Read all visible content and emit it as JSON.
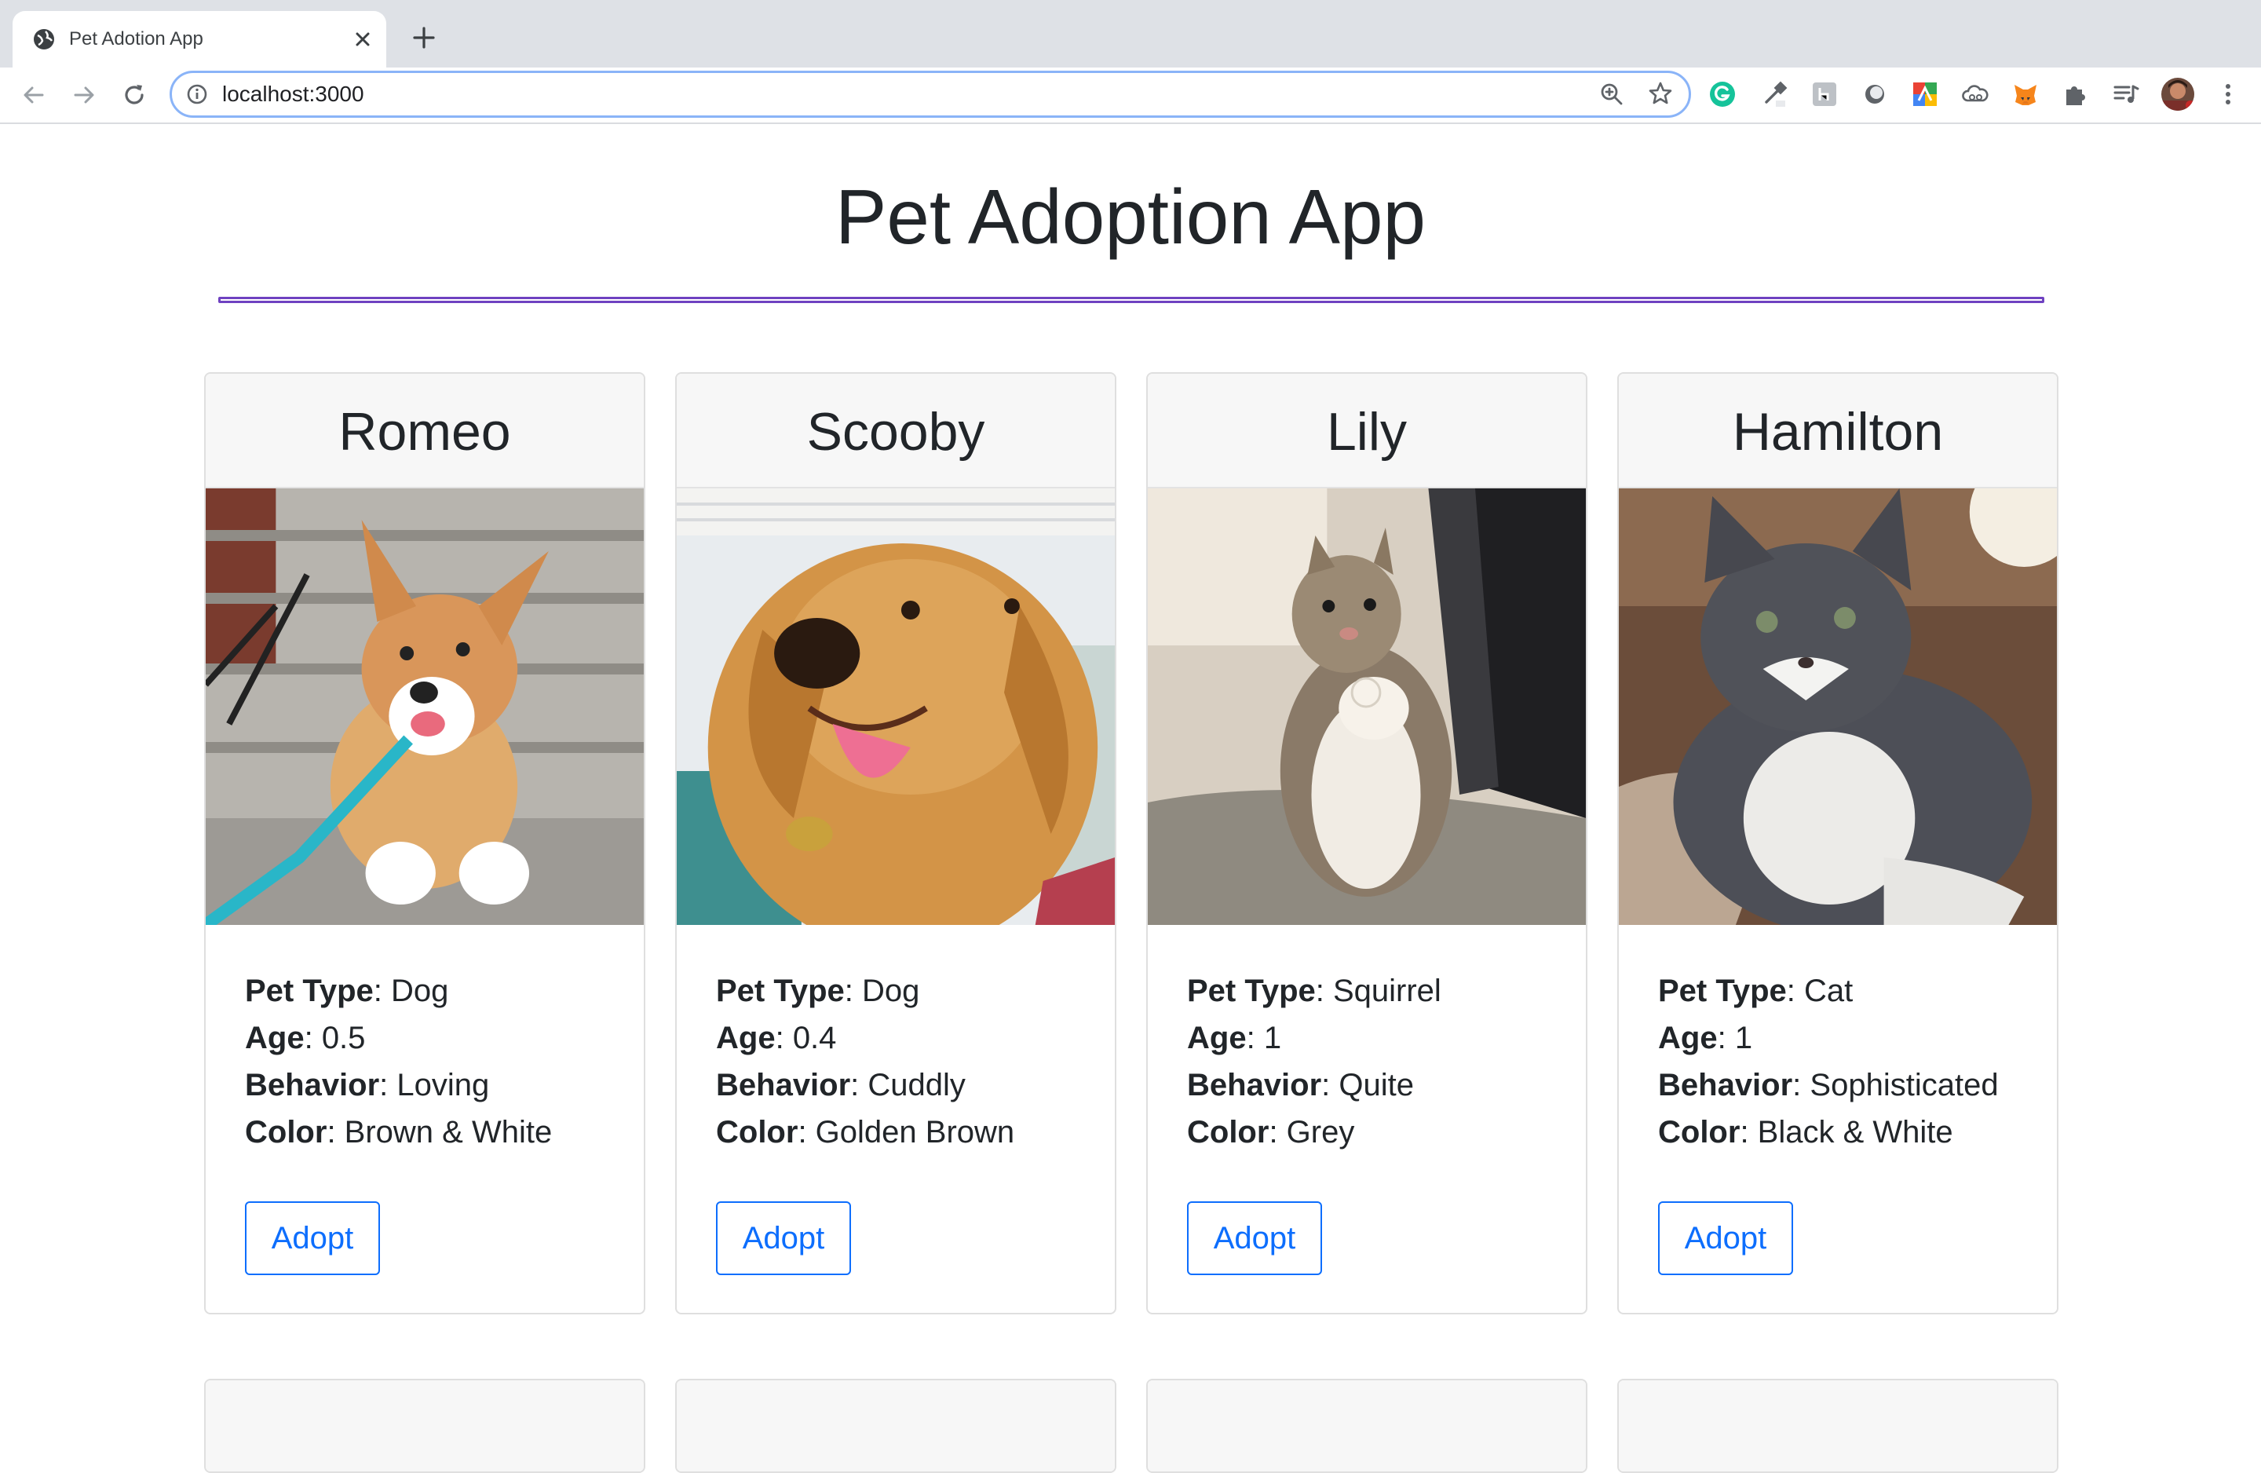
{
  "browser": {
    "tab_title": "Pet Adotion App",
    "url": "localhost:3000"
  },
  "page": {
    "title": "Pet Adoption App"
  },
  "labels": {
    "pet_type": "Pet Type",
    "age": "Age",
    "behavior": "Behavior",
    "color": "Color",
    "adopt": "Adopt"
  },
  "pets": [
    {
      "name": "Romeo",
      "type": "Dog",
      "age": "0.5",
      "behavior": "Loving",
      "color": "Brown & White"
    },
    {
      "name": "Scooby",
      "type": "Dog",
      "age": "0.4",
      "behavior": "Cuddly",
      "color": "Golden Brown"
    },
    {
      "name": "Lily",
      "type": "Squirrel",
      "age": "1",
      "behavior": "Quite",
      "color": "Grey"
    },
    {
      "name": "Hamilton",
      "type": "Cat",
      "age": "1",
      "behavior": "Sophisticated",
      "color": "Black & White"
    }
  ],
  "theme": {
    "accent_rule": "#6f42c1",
    "button_primary": "#0d6efd"
  }
}
